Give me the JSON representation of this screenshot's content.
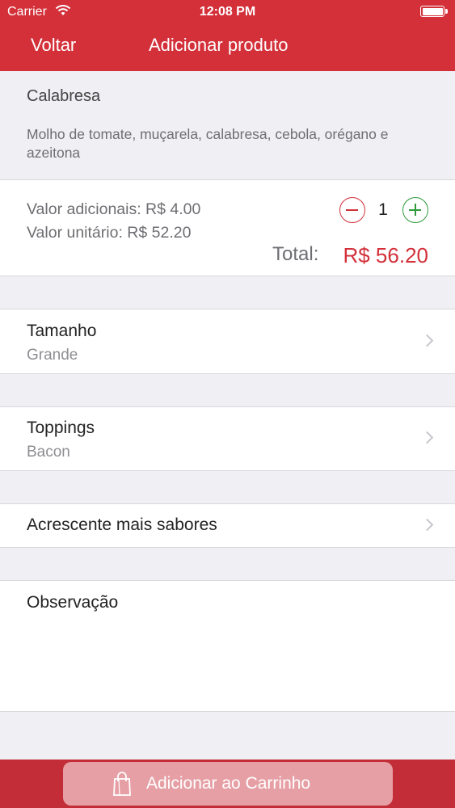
{
  "status_bar": {
    "carrier": "Carrier",
    "time": "12:08 PM"
  },
  "nav": {
    "back_label": "Voltar",
    "title": "Adicionar produto"
  },
  "product": {
    "name": "Calabresa",
    "description": "Molho de tomate, muçarela, calabresa, cebola, orégano e azeitona"
  },
  "pricing": {
    "additional": "Valor adicionais: R$ 4.00",
    "unit": "Valor unitário: R$ 52.20",
    "quantity": "1",
    "total_label": "Total:",
    "total_value": "R$ 56.20"
  },
  "options": [
    {
      "title": "Tamanho",
      "value": "Grande"
    },
    {
      "title": "Toppings",
      "value": "Bacon"
    },
    {
      "title": "Acrescente mais sabores"
    }
  ],
  "observation": {
    "label": "Observação"
  },
  "cart_button": {
    "label": "Adicionar ao Carrinho"
  },
  "icons": {
    "wifi": "wifi-icon",
    "battery": "battery-icon",
    "minus": "minus-circle-icon",
    "plus": "plus-circle-icon",
    "chevron": "chevron-right-icon",
    "bag": "shopping-bag-icon"
  },
  "colors": {
    "brand_red": "#d3303a",
    "plus_green": "#2d9b3a",
    "footer_red": "#c22d37",
    "button_pink": "#e6a0a5"
  }
}
